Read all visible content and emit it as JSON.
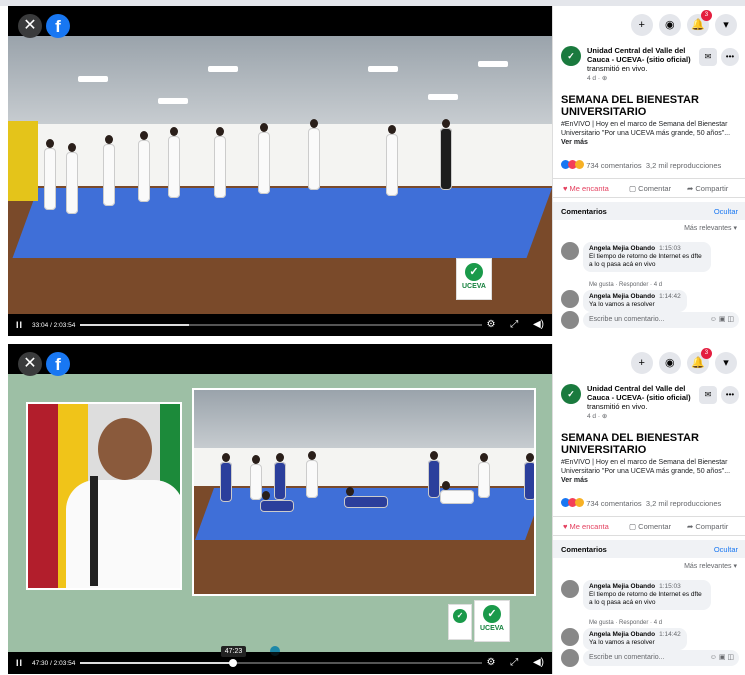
{
  "player": {
    "close_icon": "close-icon",
    "fb_logo": "f"
  },
  "video1": {
    "current_time": "33:04 / 2:03:54",
    "progress_fraction": 0.27
  },
  "video2": {
    "current_time": "47:30 / 2:03:54",
    "tooltip": "47:23",
    "progress_fraction": 0.38
  },
  "logo": {
    "text": "UCEVA"
  },
  "sidebar": {
    "page_name": "Unidad Central del Valle del Cauca - UCEVA- (sitio oficial)",
    "page_action": "transmitió en vivo.",
    "post_age": "4 d",
    "title": "SEMANA DEL BIENESTAR UNIVERSITARIO",
    "body": "#EnVIVO | Hoy en el marco de Semana del Bienestar Universitario \"Por una UCEVA más grande, 50 años\"...",
    "see_more": "Ver más",
    "comment_count": "734 comentarios",
    "view_count": "3,2 mil reproducciones",
    "like_label": "Me encanta",
    "comment_label": "Comentar",
    "share_label": "Compartir",
    "comments_header": "Comentarios",
    "hide_label": "Ocultar",
    "sort_label": "Más relevantes",
    "notification_count": "3",
    "comments": [
      {
        "author": "Angela Mejia Obando",
        "time": "1:15:03",
        "text": "El tiempo de retorno de Internet es dfte a lo q pasa acá en vivo",
        "actions": "Me gusta · Responder · 4 d"
      },
      {
        "author": "Angela Mejia Obando",
        "time": "1:14:42",
        "text": "Ya lo vamos a resolver",
        "actions": ""
      }
    ],
    "write_placeholder": "Escribe un comentario..."
  }
}
